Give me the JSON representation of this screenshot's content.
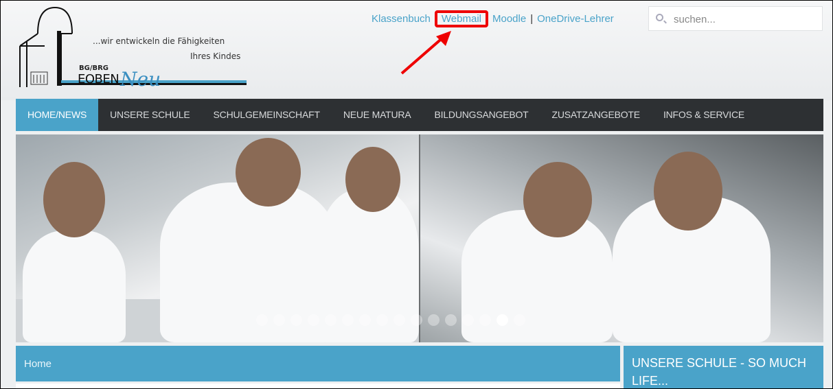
{
  "logo": {
    "tagline1": "...wir entwickeln die Fähigkeiten",
    "tagline2": "Ihres Kindes",
    "small": "BG/BRG",
    "big": "EOBEN",
    "neu": "Neu"
  },
  "toplinks": {
    "klassenbuch": "Klassenbuch",
    "webmail": "Webmail",
    "moodle": "Moodle",
    "separator": "|",
    "onedrive": "OneDrive-Lehrer"
  },
  "search": {
    "placeholder": "suchen..."
  },
  "nav": {
    "items": [
      {
        "label": "HOME/NEWS"
      },
      {
        "label": "UNSERE SCHULE"
      },
      {
        "label": "SCHULGEMEINSCHAFT"
      },
      {
        "label": "NEUE MATURA"
      },
      {
        "label": "BILDUNGSANGEBOT"
      },
      {
        "label": "ZUSATZANGEBOTE"
      },
      {
        "label": "INFOS & SERVICE"
      }
    ]
  },
  "slider": {
    "slide_count": 16,
    "active_index": 14
  },
  "breadcrumb": {
    "home": "Home"
  },
  "sidebar": {
    "title": "UNSERE SCHULE - SO MUCH LIFE..."
  },
  "colors": {
    "accent": "#4aa3c9",
    "nav_bg": "#2d3033",
    "highlight": "#e00000"
  },
  "icons": {
    "search": "search-icon",
    "annotation_arrow": "red-arrow-icon"
  }
}
